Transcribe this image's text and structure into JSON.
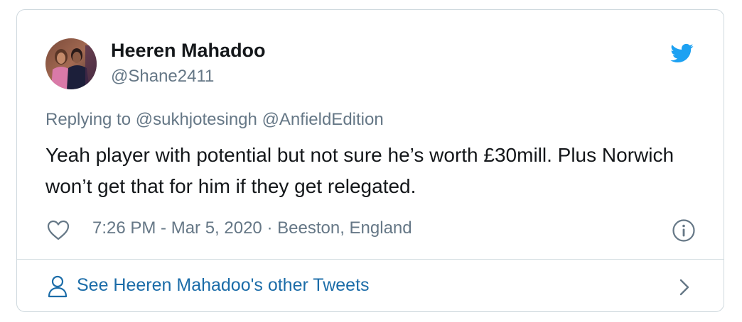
{
  "tweet": {
    "author_name": "Heeren Mahadoo",
    "author_handle": "@Shane2411",
    "replying_prefix": "Replying to",
    "replying_mentions": [
      "@sukhjotesingh",
      "@AnfieldEdition"
    ],
    "text": "Yeah player with potential but not sure he’s worth £30mill. Plus Norwich won’t get that for him if they get relegated.",
    "time": "7:26 PM - Mar 5, 2020",
    "separator": "·",
    "location": "Beeston, England"
  },
  "footer": {
    "label": "See Heeren Mahadoo's other Tweets"
  },
  "icons": {
    "brand": "twitter-bird-icon",
    "like": "heart-icon",
    "info": "info-icon",
    "profile": "person-icon",
    "more": "chevron-right-icon"
  },
  "colors": {
    "twitter_blue": "#1da1f2",
    "link": "#1b6ca8",
    "text": "#14171a",
    "muted": "#657786",
    "border": "#cfd9de"
  }
}
